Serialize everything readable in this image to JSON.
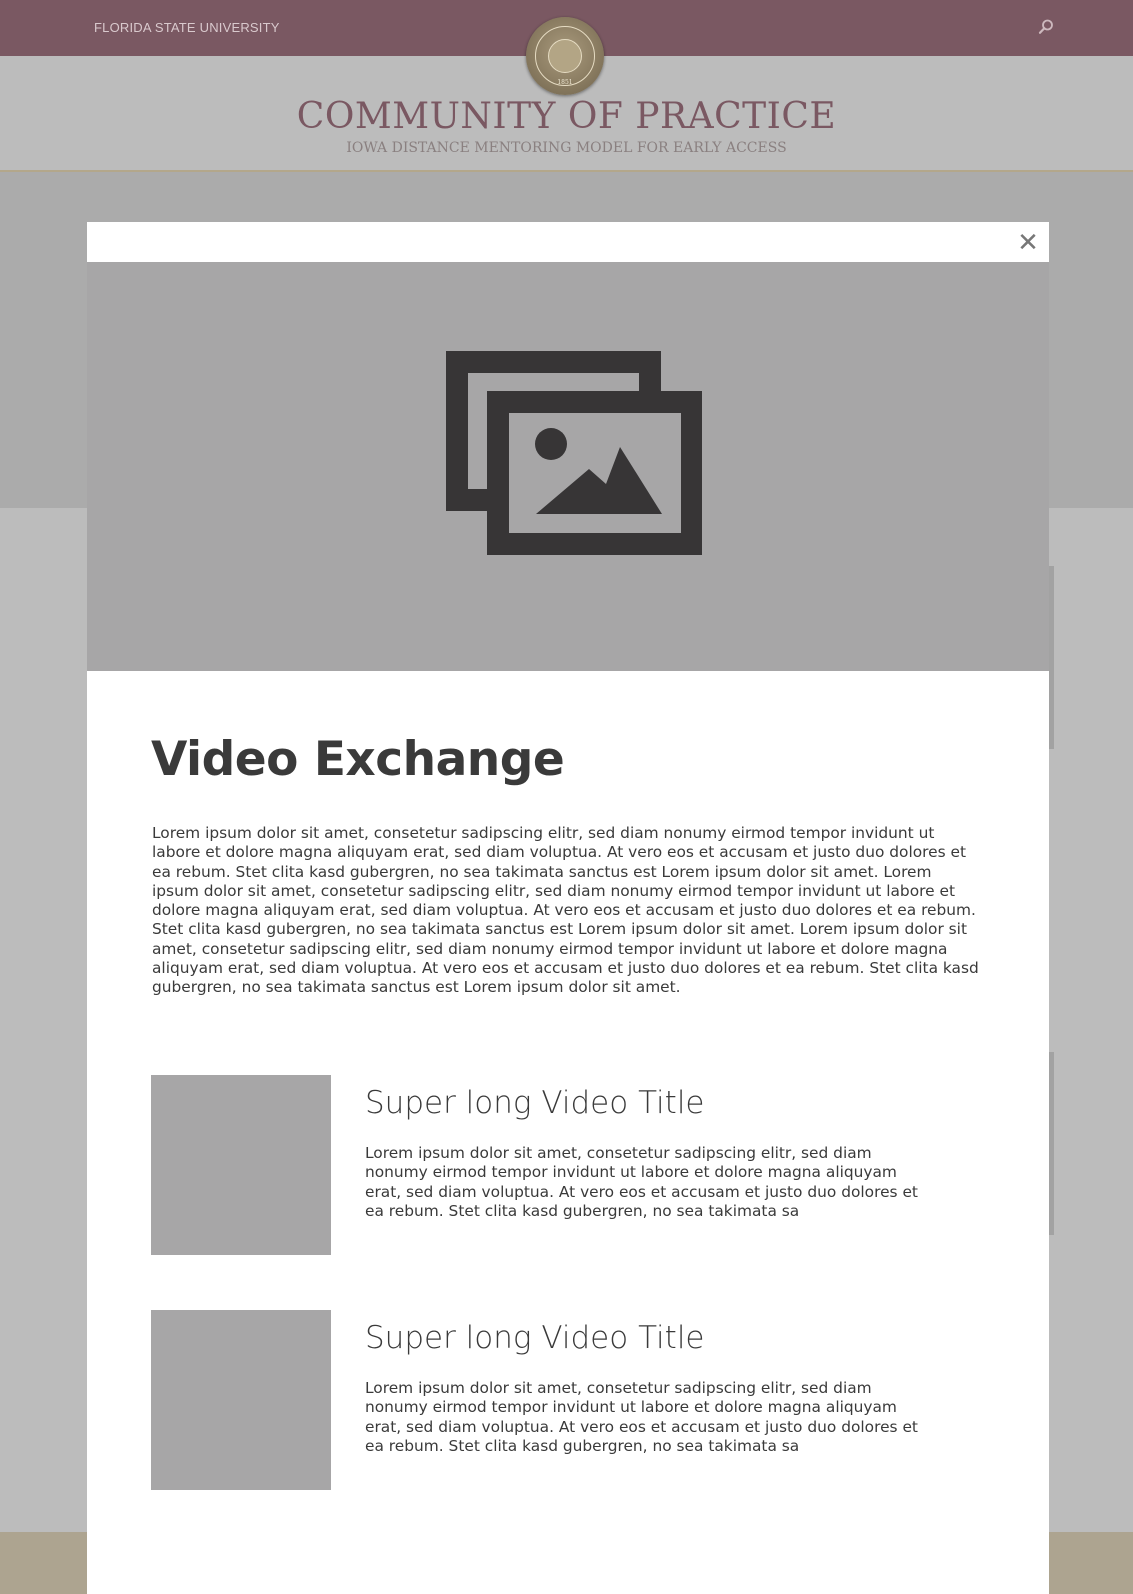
{
  "topbar": {
    "university": "FLORIDA STATE UNIVERSITY",
    "search_icon": "search-icon",
    "seal_year": "1851",
    "background_color": "#7a5862"
  },
  "header": {
    "title": "COMMUNITY OF PRACTICE",
    "subtitle": "IOWA DISTANCE MENTORING MODEL FOR EARLY ACCESS",
    "accent_color": "#7a5862"
  },
  "modal": {
    "close_icon": "close-icon",
    "close_glyph": "✕",
    "hero_icon": "image-gallery-icon",
    "heading": "Video Exchange",
    "intro": "Lorem ipsum dolor sit amet, consetetur sadipscing elitr, sed diam nonumy eirmod tempor invidunt ut labore et dolore magna aliquyam erat, sed diam voluptua. At vero eos et accusam et justo duo dolores et ea rebum. Stet clita kasd gubergren, no sea takimata sanctus est Lorem ipsum dolor sit amet. Lorem ipsum dolor sit amet, consetetur sadipscing elitr, sed diam nonumy eirmod tempor invidunt ut labore et dolore magna aliquyam erat, sed diam voluptua. At vero eos et accusam et justo duo dolores et ea rebum. Stet clita kasd gubergren, no sea takimata sanctus est Lorem ipsum dolor sit amet. Lorem ipsum dolor sit amet, consetetur sadipscing elitr, sed diam nonumy eirmod tempor invidunt ut labore et dolore magna aliquyam erat, sed diam voluptua. At vero eos et accusam et justo duo dolores et ea rebum. Stet clita kasd gubergren, no sea takimata sanctus est Lorem ipsum dolor sit amet.",
    "videos": [
      {
        "title": "Super long Video Title",
        "description": "Lorem ipsum dolor sit amet, consetetur sadipscing elitr, sed diam nonumy eirmod tempor invidunt ut labore et dolore magna aliquyam erat, sed diam voluptua. At vero eos et accusam et justo duo dolores et ea rebum. Stet clita kasd gubergren, no sea takimata sa"
      },
      {
        "title": "Super long Video Title",
        "description": "Lorem ipsum dolor sit amet, consetetur sadipscing elitr, sed diam nonumy eirmod tempor invidunt ut labore et dolore magna aliquyam erat, sed diam voluptua. At vero eos et accusam et justo duo dolores et ea rebum. Stet clita kasd gubergren, no sea takimata sa"
      }
    ]
  }
}
